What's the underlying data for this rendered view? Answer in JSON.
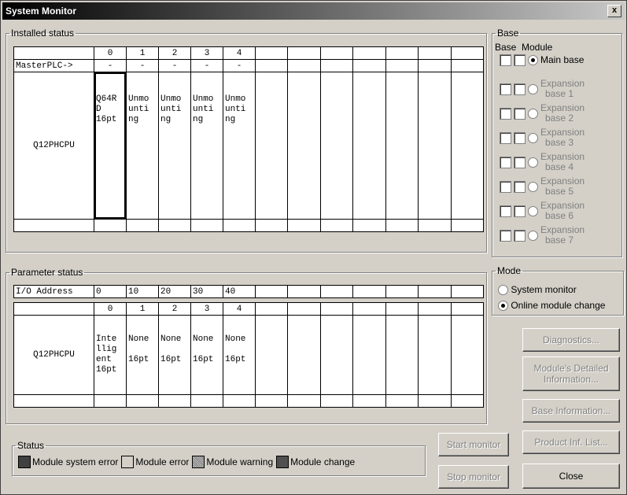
{
  "window": {
    "title": "System Monitor",
    "close_glyph": "x"
  },
  "installed": {
    "legend": "Installed status",
    "cols": [
      "0",
      "1",
      "2",
      "3",
      "4"
    ],
    "master_label": "MasterPLC->",
    "master_vals": [
      "-",
      "-",
      "-",
      "-",
      "-"
    ],
    "cpu": "Q12PHCPU",
    "modules": [
      [
        "Q64R",
        "D",
        "16pt"
      ],
      [
        "Unmo",
        "unti",
        "ng"
      ],
      [
        "Unmo",
        "unti",
        "ng"
      ],
      [
        "Unmo",
        "unti",
        "ng"
      ],
      [
        "Unmo",
        "unti",
        "ng"
      ]
    ]
  },
  "base": {
    "legend": "Base",
    "col_base": "Base",
    "col_module": "Module",
    "items": [
      {
        "l1": "Main base",
        "l2": "",
        "selected": true
      },
      {
        "l1": "Expansion",
        "l2": "base 1",
        "selected": false
      },
      {
        "l1": "Expansion",
        "l2": "base 2",
        "selected": false
      },
      {
        "l1": "Expansion",
        "l2": "base 3",
        "selected": false
      },
      {
        "l1": "Expansion",
        "l2": "base 4",
        "selected": false
      },
      {
        "l1": "Expansion",
        "l2": "base 5",
        "selected": false
      },
      {
        "l1": "Expansion",
        "l2": "base 6",
        "selected": false
      },
      {
        "l1": "Expansion",
        "l2": "base 7",
        "selected": false
      }
    ]
  },
  "parameter": {
    "legend": "Parameter status",
    "io_label": "I/O Address",
    "io_vals": [
      "0",
      "10",
      "20",
      "30",
      "40"
    ],
    "cols": [
      "0",
      "1",
      "2",
      "3",
      "4"
    ],
    "cpu": "Q12PHCPU",
    "modules": [
      [
        "Inte",
        "llig",
        "ent",
        "16pt"
      ],
      [
        "None",
        "",
        "16pt",
        ""
      ],
      [
        "None",
        "",
        "16pt",
        ""
      ],
      [
        "None",
        "",
        "16pt",
        ""
      ],
      [
        "None",
        "",
        "16pt",
        ""
      ]
    ]
  },
  "mode": {
    "legend": "Mode",
    "options": [
      {
        "label": "System monitor",
        "selected": false
      },
      {
        "label": "Online module change",
        "selected": true
      }
    ]
  },
  "buttons": {
    "diagnostics": "Diagnostics...",
    "module_detail_1": "Module's Detailed",
    "module_detail_2": "Information...",
    "base_info": "Base Information...",
    "product_inf": "Product Inf. List...",
    "start_monitor": "Start monitor",
    "stop_monitor": "Stop monitor",
    "close": "Close"
  },
  "status": {
    "legend": "Status",
    "items": [
      {
        "label": "Module system error",
        "color": "#404040"
      },
      {
        "label": "Module error",
        "color": "#d4d0c8"
      },
      {
        "label": "Module warning",
        "color": "#a0a0a0"
      },
      {
        "label": "Module change",
        "color": "#505050"
      }
    ]
  }
}
